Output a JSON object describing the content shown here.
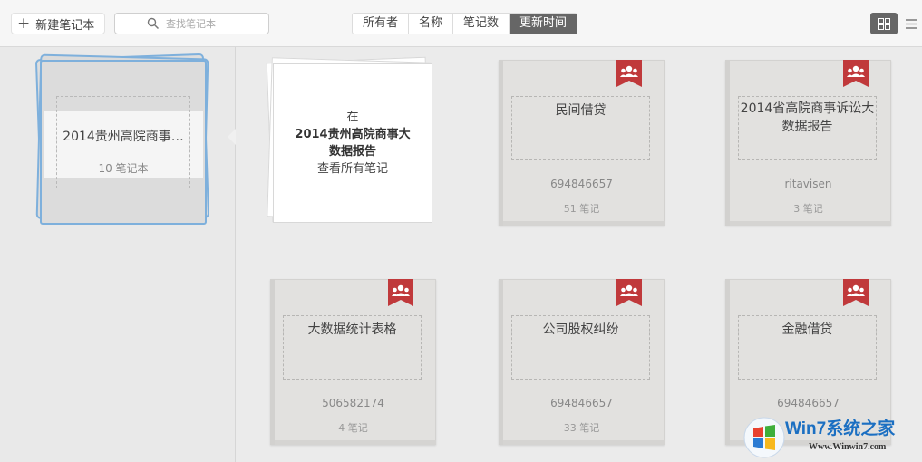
{
  "toolbar": {
    "new_notebook": "新建笔记本",
    "search_placeholder": "查找笔记本",
    "sort_tabs": [
      "所有者",
      "名称",
      "笔记数",
      "更新时间"
    ],
    "active_sort": "更新时间",
    "view_modes": [
      "grid-icon",
      "list-icon"
    ],
    "active_view": "grid"
  },
  "stack": {
    "title": "2014贵州高院商事…",
    "count": "10 笔记本"
  },
  "intro_card": {
    "line1": "在",
    "line2": "2014贵州高院商事大",
    "line3": "数据报告",
    "line4": "查看所有笔记"
  },
  "notebooks": [
    {
      "name": "民间借贷",
      "owner": "694846657",
      "notes": "51 笔记",
      "badge": "shared-group-icon"
    },
    {
      "name": "2014省高院商事诉讼大数据报告",
      "owner": "ritavisen",
      "notes": "3 笔记",
      "badge": "shared-group-icon"
    },
    {
      "name": "大数据统计表格",
      "owner": "506582174",
      "notes": "4 笔记",
      "badge": "shared-group-icon"
    },
    {
      "name": "公司股权纠纷",
      "owner": "694846657",
      "notes": "33 笔记",
      "badge": "shared-group-icon"
    },
    {
      "name": "金融借贷",
      "owner": "694846657",
      "notes": "",
      "badge": "shared-group-icon"
    }
  ],
  "watermark": {
    "title": "Win7系统之家",
    "url": "Www.Winwin7.com"
  },
  "colors": {
    "badge_red": "#c0393b",
    "selection_blue": "#7eb0dc",
    "active_segment": "#666666"
  }
}
